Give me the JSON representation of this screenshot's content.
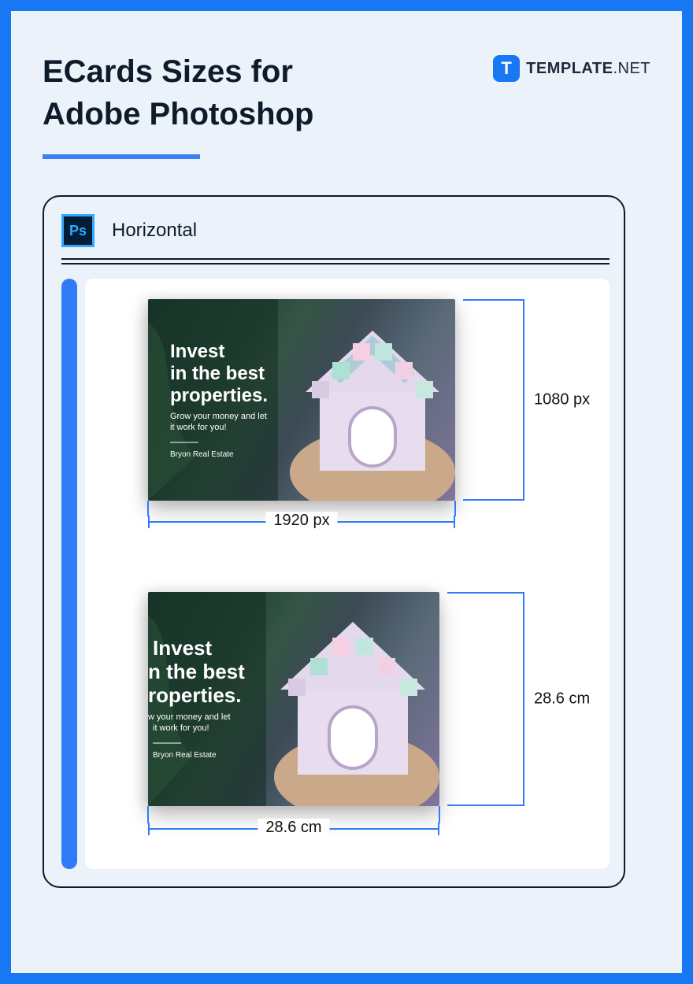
{
  "header": {
    "title_line1": "ECards Sizes for",
    "title_line2": "Adobe Photoshop"
  },
  "brand": {
    "icon_letter": "T",
    "name_bold": "TEMPLATE",
    "name_suffix": ".NET"
  },
  "window": {
    "app_label": "Ps",
    "layout_label": "Horizontal"
  },
  "cards": [
    {
      "headline_l1": "Invest",
      "headline_l2": "in the best",
      "headline_l3": "properties.",
      "sub_l1": "Grow your money and let",
      "sub_l2": "it work for you!",
      "footer": "Bryon Real Estate",
      "width_label": "1920 px",
      "height_label": "1080 px"
    },
    {
      "headline_l1": "Invest",
      "headline_l2": "n the best",
      "headline_l3": "roperties.",
      "sub_l1": "w your money and let",
      "sub_l2": "it work for you!",
      "footer": "Bryon Real Estate",
      "width_label": "28.6 cm",
      "height_label": "28.6 cm"
    }
  ]
}
